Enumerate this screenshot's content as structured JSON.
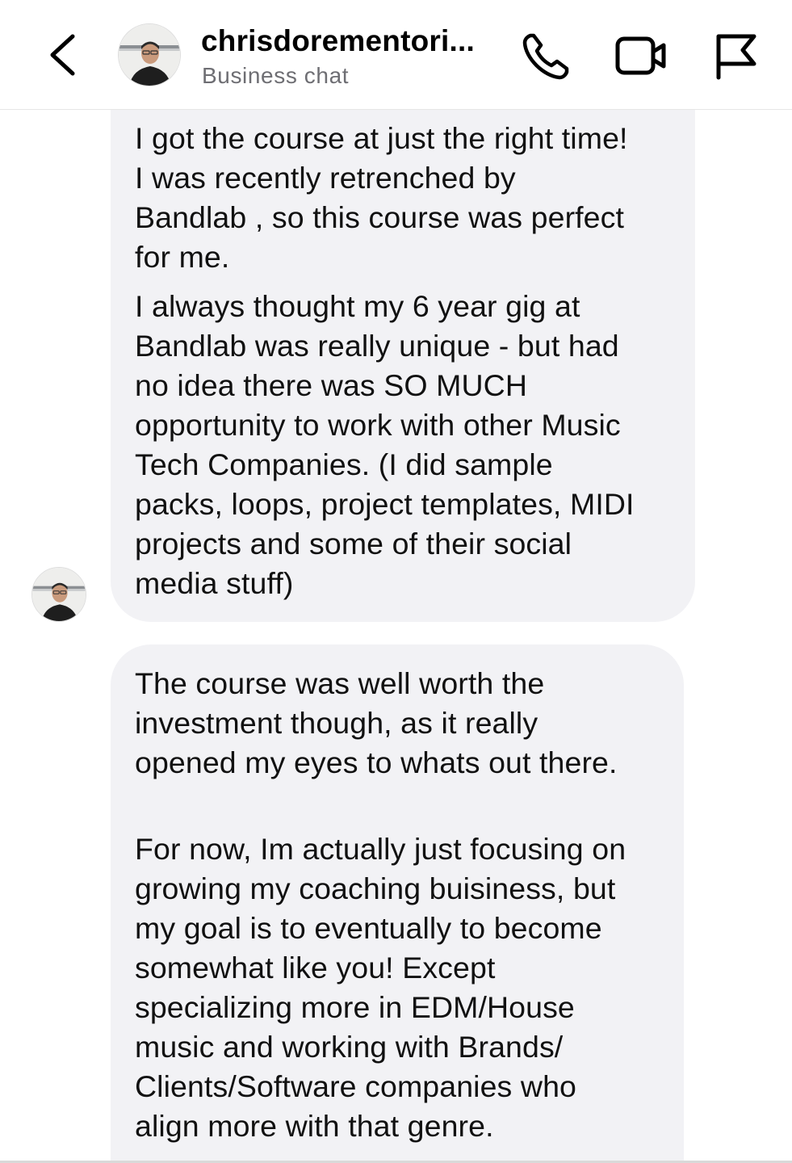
{
  "header": {
    "title": "chrisdorementori...",
    "subtitle": "Business chat",
    "icons": {
      "back": "chevron-left-icon",
      "phone": "phone-icon",
      "video": "video-camera-icon",
      "report": "flag-icon"
    }
  },
  "messages": [
    {
      "paragraphs": [
        "I got the course at just the right time!\n I was recently retrenched by\nBandlab , so this course was perfect\nfor me.",
        "I always thought my 6 year gig at\nBandlab was really unique - but had\nno idea there was SO MUCH\nopportunity to work with other Music\nTech Companies. (I did sample\npacks, loops, project templates, MIDI\nprojects and some of their social\nmedia stuff)"
      ]
    },
    {
      "paragraphs": [
        "The course was well worth the\ninvestment though, as it really\nopened my eyes to whats out there.",
        "For now, Im actually just focusing on\ngrowing my coaching buisiness, but\nmy goal is to eventually to become\nsomewhat like you! Except\nspecializing more in EDM/House\nmusic and working with Brands/\nClients/Software companies who\nalign more with that genre."
      ]
    }
  ],
  "colors": {
    "bubble": "#f2f2f5",
    "subtitle": "#6e6e73",
    "text": "#111111"
  }
}
